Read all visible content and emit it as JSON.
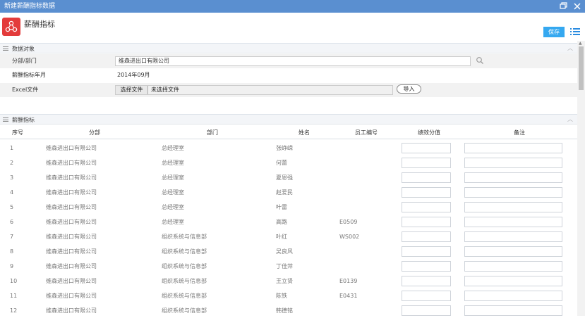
{
  "window": {
    "title": "新建薪酬指标数据"
  },
  "header": {
    "title": "薪酬指标",
    "save_label": "保存"
  },
  "data_object": {
    "section_title": "数据对象",
    "fields": {
      "dept_label": "分部/部门",
      "dept_value": "维森进出口有限公司",
      "month_label": "薪酬指标年月",
      "month_value": "2014年09月",
      "excel_label": "Excel文件",
      "choose_file_label": "选择文件",
      "no_file_text": "未选择文件",
      "import_label": "导入"
    }
  },
  "indicator": {
    "section_title": "薪酬指标",
    "columns": [
      "序号",
      "分部",
      "部门",
      "姓名",
      "员工编号",
      "绩效分值",
      "备注"
    ],
    "rows": [
      {
        "no": "1",
        "company": "维森进出口有限公司",
        "dept": "总经理室",
        "name": "张峥嵘",
        "emp_id": ""
      },
      {
        "no": "2",
        "company": "维森进出口有限公司",
        "dept": "总经理室",
        "name": "何蕾",
        "emp_id": ""
      },
      {
        "no": "3",
        "company": "维森进出口有限公司",
        "dept": "总经理室",
        "name": "夏恩强",
        "emp_id": ""
      },
      {
        "no": "4",
        "company": "维森进出口有限公司",
        "dept": "总经理室",
        "name": "赵爱民",
        "emp_id": ""
      },
      {
        "no": "5",
        "company": "维森进出口有限公司",
        "dept": "总经理室",
        "name": "叶雷",
        "emp_id": ""
      },
      {
        "no": "6",
        "company": "维森进出口有限公司",
        "dept": "总经理室",
        "name": "高路",
        "emp_id": "E0509"
      },
      {
        "no": "7",
        "company": "维森进出口有限公司",
        "dept": "组织系统与信息部",
        "name": "叶红",
        "emp_id": "WS002"
      },
      {
        "no": "8",
        "company": "维森进出口有限公司",
        "dept": "组织系统与信息部",
        "name": "吴良风",
        "emp_id": ""
      },
      {
        "no": "9",
        "company": "维森进出口有限公司",
        "dept": "组织系统与信息部",
        "name": "丁佳萍",
        "emp_id": ""
      },
      {
        "no": "10",
        "company": "维森进出口有限公司",
        "dept": "组织系统与信息部",
        "name": "王立贤",
        "emp_id": "E0139"
      },
      {
        "no": "11",
        "company": "维森进出口有限公司",
        "dept": "组织系统与信息部",
        "name": "陈铁",
        "emp_id": "E0431"
      },
      {
        "no": "12",
        "company": "维森进出口有限公司",
        "dept": "组织系统与信息部",
        "name": "韩德铭",
        "emp_id": ""
      }
    ]
  },
  "colors": {
    "titlebar": "#5a8fd0",
    "accent": "#35a8f0",
    "app_icon": "#e33b3b"
  },
  "icons": [
    "restore-icon",
    "close-icon",
    "app-share-icon",
    "list-menu-icon",
    "search-icon",
    "collapse-caret-icon"
  ]
}
